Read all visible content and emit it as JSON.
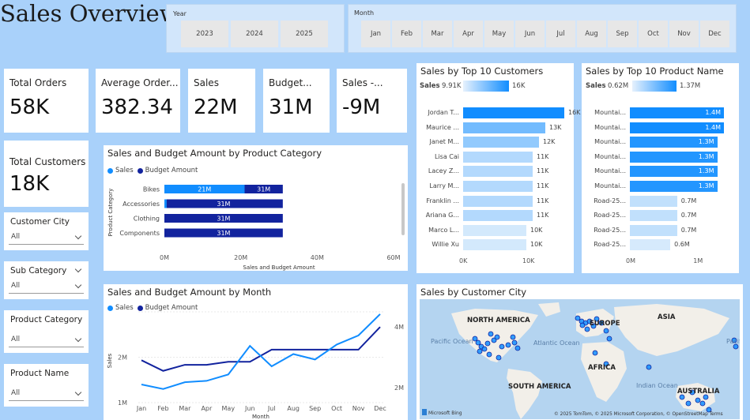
{
  "page": {
    "title": "Sales Overview"
  },
  "year_slicer": {
    "label": "Year",
    "options": [
      "2023",
      "2024",
      "2025"
    ]
  },
  "month_slicer": {
    "label": "Month",
    "options": [
      "Jan",
      "Feb",
      "Mar",
      "Apr",
      "May",
      "Jun",
      "Jul",
      "Aug",
      "Sep",
      "Oct",
      "Nov",
      "Dec"
    ]
  },
  "kpis": [
    {
      "label": "Total Orders",
      "value": "58K"
    },
    {
      "label": "Average Order...",
      "value": "382.34"
    },
    {
      "label": "Sales",
      "value": "22M"
    },
    {
      "label": "Budget...",
      "value": "31M"
    },
    {
      "label": "Sales -...",
      "value": "-9M"
    }
  ],
  "total_customers": {
    "label": "Total Customers",
    "value": "18K"
  },
  "filters": [
    {
      "label": "Customer City",
      "value": "All"
    },
    {
      "label": "Sub Category",
      "value": "All"
    },
    {
      "label": "Product Category",
      "value": "All"
    },
    {
      "label": "Product Name",
      "value": "All"
    }
  ],
  "colors": {
    "sales": "#118dff",
    "budget": "#12239e",
    "light_bar": "#d0e6fc",
    "bg": "#a9d1fa"
  },
  "chart_data": [
    {
      "id": "category",
      "type": "bar",
      "title": "Sales and Budget Amount by Product Category",
      "legend": [
        "Sales",
        "Budget Amount"
      ],
      "ylabel": "Product Category",
      "xlabel": "Sales and Budget Amount",
      "categories": [
        "Bikes",
        "Accessories",
        "Clothing",
        "Components"
      ],
      "series": [
        {
          "name": "Sales",
          "values": [
            21,
            0.6,
            0,
            0
          ],
          "labels": [
            "21M",
            "",
            "",
            ""
          ]
        },
        {
          "name": "Budget Amount",
          "values": [
            31,
            31,
            31,
            31
          ],
          "labels": [
            "31M",
            "31M",
            "31M",
            "31M"
          ]
        }
      ],
      "xticks": [
        "0M",
        "20M",
        "40M",
        "60M"
      ],
      "xlim": [
        0,
        60
      ]
    },
    {
      "id": "month",
      "type": "line",
      "title": "Sales and Budget Amount by Month",
      "legend": [
        "Sales",
        "Budget Amount"
      ],
      "ylabel": "Sales",
      "xlabel": "Month",
      "x": [
        "Jan",
        "Feb",
        "Mar",
        "Apr",
        "May",
        "Jun",
        "Jul",
        "Aug",
        "Sep",
        "Oct",
        "Nov",
        "Dec"
      ],
      "series": [
        {
          "name": "Sales",
          "values": [
            1.4,
            1.3,
            1.45,
            1.48,
            1.62,
            2.25,
            1.8,
            2.07,
            1.95,
            2.28,
            2.48,
            2.95
          ]
        },
        {
          "name": "Budget Amount",
          "values": [
            2.9,
            2.55,
            2.75,
            2.75,
            2.85,
            2.85,
            3.25,
            3.25,
            3.25,
            3.25,
            3.25,
            4.0
          ]
        }
      ],
      "left_ticks": [
        "1M",
        "2M"
      ],
      "left_ylim": [
        1.0,
        3.0
      ],
      "right_ticks": [
        "2M",
        "4M"
      ],
      "right_ylim": [
        1.5,
        4.5
      ]
    },
    {
      "id": "customers",
      "type": "bar",
      "title": "Sales by Top 10 Customers",
      "gradient_legend": {
        "field": "Sales",
        "min": "9.91K",
        "max": "16K"
      },
      "categories": [
        "Jordan T...",
        "Maurice ...",
        "Janet M...",
        "Lisa Cai",
        "Lacey Z...",
        "Larry M...",
        "Franklin ...",
        "Ariana G...",
        "Marco L...",
        "Willie Xu"
      ],
      "values": [
        16,
        13,
        12,
        11,
        11,
        11,
        11,
        11,
        10,
        10
      ],
      "labels": [
        "16K",
        "13K",
        "12K",
        "11K",
        "11K",
        "11K",
        "11K",
        "11K",
        "10K",
        "10K"
      ],
      "xticks": [
        "0K",
        "10K"
      ],
      "xlim": [
        0,
        20
      ]
    },
    {
      "id": "products",
      "type": "bar",
      "title": "Sales by Top 10 Product Name",
      "gradient_legend": {
        "field": "Sales",
        "min": "0.62M",
        "max": "1.37M"
      },
      "categories": [
        "Mountai...",
        "Mountai...",
        "Mountai...",
        "Mountai...",
        "Mountai...",
        "Mountai...",
        "Road-25...",
        "Road-25...",
        "Road-25...",
        "Road-25..."
      ],
      "values": [
        1.4,
        1.4,
        1.3,
        1.3,
        1.3,
        1.3,
        0.7,
        0.7,
        0.7,
        0.6
      ],
      "labels": [
        "1.4M",
        "1.4M",
        "1.3M",
        "1.3M",
        "1.3M",
        "1.3M",
        "0.7M",
        "0.7M",
        "0.7M",
        "0.6M"
      ],
      "xticks": [
        "0M",
        "1M"
      ],
      "xlim": [
        0,
        1.7
      ]
    }
  ],
  "map": {
    "title": "Sales by Customer City",
    "labels": [
      "NORTH AMERICA",
      "EUROPE",
      "ASIA",
      "AFRICA",
      "SOUTH AMERICA",
      "AUSTRALIA",
      "Pacific Ocean",
      "Atlantic Ocean",
      "Indian Ocean",
      "Pacific Ocean"
    ],
    "credit_logo": "Microsoft Bing",
    "attribution": "© 2025 TomTom, © 2025 Microsoft Corporation, © OpenStreetMap Terms"
  }
}
